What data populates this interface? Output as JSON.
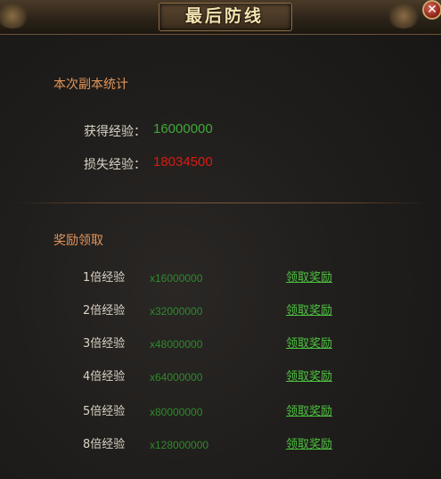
{
  "window": {
    "title": "最后防线",
    "close_glyph": "✕"
  },
  "stats": {
    "heading": "本次副本统计",
    "gained": {
      "label": "获得经验：",
      "value": "16000000"
    },
    "lost": {
      "label": "损失经验：",
      "value": "18034500"
    }
  },
  "rewards": {
    "heading": "奖励领取",
    "items": [
      {
        "label": "1倍经验",
        "amount": "x16000000",
        "action": "领取奖励"
      },
      {
        "label": "2倍经验",
        "amount": "x32000000",
        "action": "领取奖励"
      },
      {
        "label": "3倍经验",
        "amount": "x48000000",
        "action": "领取奖励"
      },
      {
        "label": "4倍经验",
        "amount": "x64000000",
        "action": "领取奖励"
      },
      {
        "label": "5倍经验",
        "amount": "x80000000",
        "action": "领取奖励"
      },
      {
        "label": "8倍经验",
        "amount": "x128000000",
        "action": "领取奖励"
      }
    ]
  },
  "colors": {
    "gain": "#3fa83a",
    "loss": "#d71c13",
    "section_heading": "#e3955a",
    "claim_link": "#4cc43f"
  }
}
